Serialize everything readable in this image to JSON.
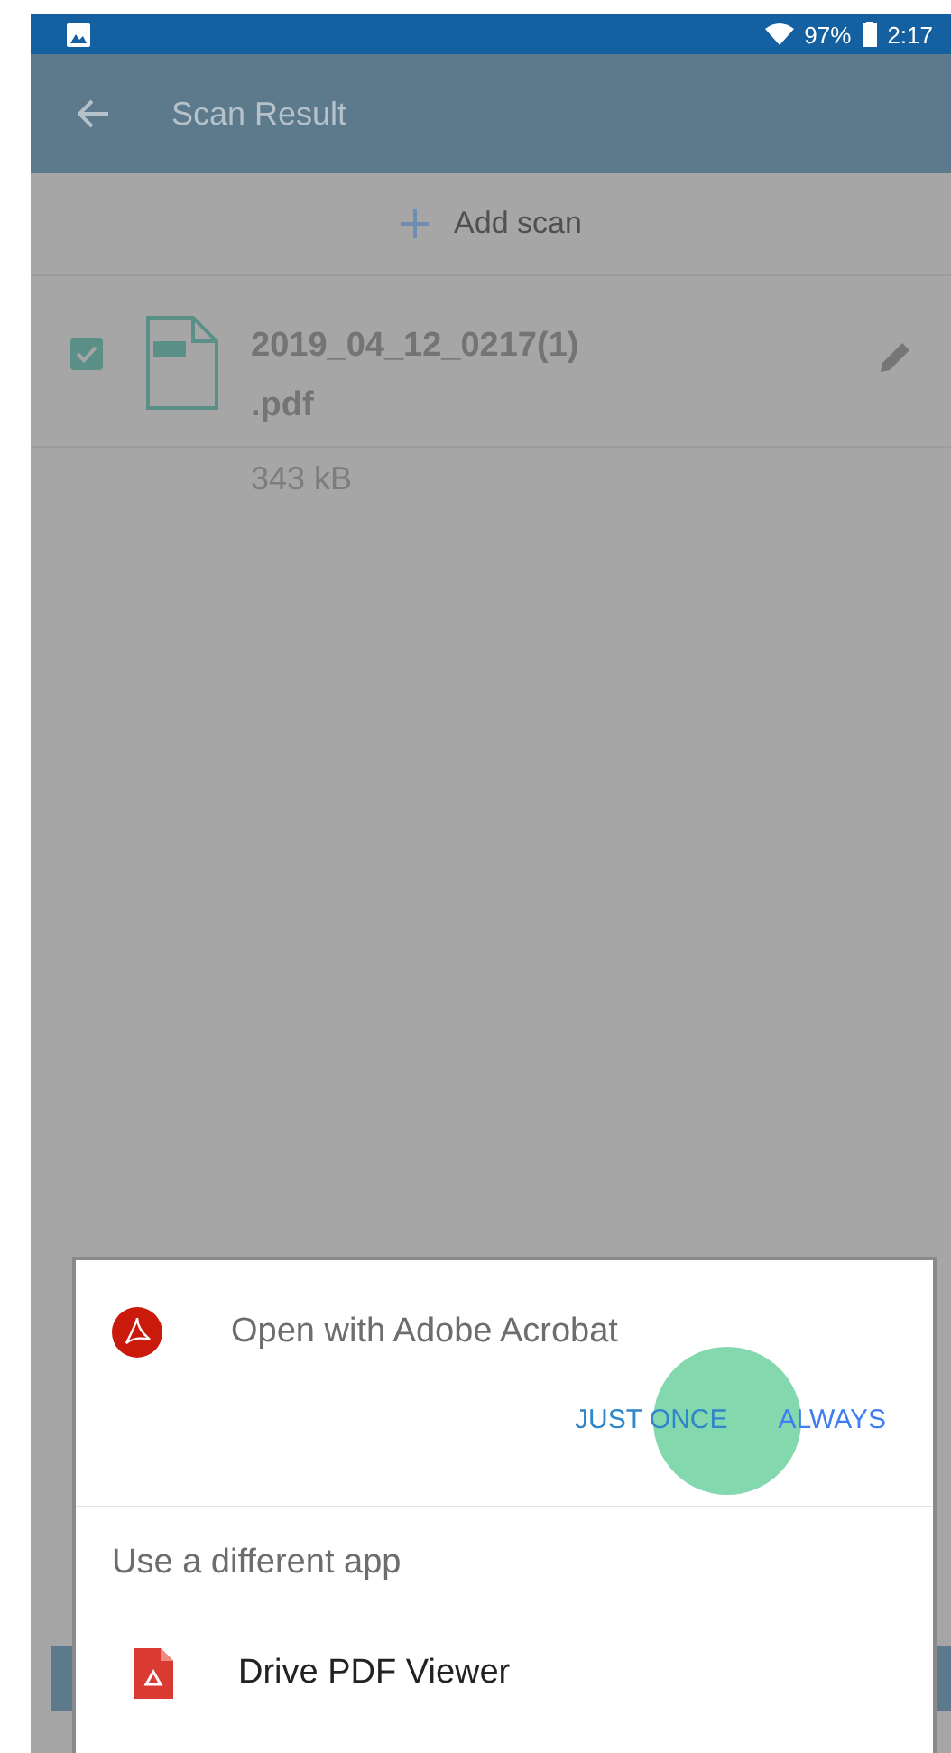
{
  "status_bar": {
    "battery": "97%",
    "time": "2:17"
  },
  "app_bar": {
    "title": "Scan Result"
  },
  "add_scan": {
    "label": "Add scan"
  },
  "files": [
    {
      "name": "2019_04_12_0217(1)\n.pdf",
      "size": "343 kB",
      "checked": true
    }
  ],
  "dialog": {
    "title": "Open with Adobe Acrobat",
    "buttons": [
      {
        "label": "JUST ONCE",
        "pressed": true
      },
      {
        "label": "ALWAYS",
        "pressed": false
      }
    ],
    "other_heading": "Use a different app",
    "apps": [
      {
        "name": "Drive PDF Viewer"
      }
    ]
  }
}
